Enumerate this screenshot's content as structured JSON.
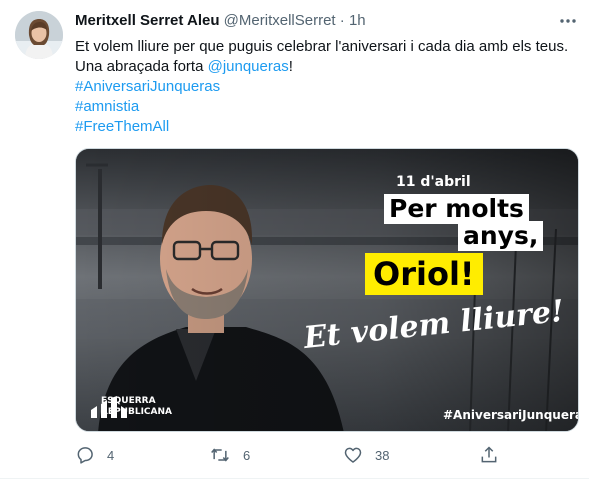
{
  "tweet": {
    "author_name": "Meritxell Serret Aleu",
    "author_handle": "@MeritxellSerret",
    "separator": "·",
    "time": "1h",
    "text_line1": "Et volem lliure per que puguis celebrar l'aniversari i cada dia amb els teus.",
    "text_line2_prefix": "Una abraçada forta ",
    "mention": "@junqueras",
    "text_line2_suffix": "!",
    "hashtags": [
      "#AniversariJunqueras",
      "#amnistia",
      "#FreeThemAll"
    ]
  },
  "image": {
    "date": "11 d'abril",
    "line1": "Per molts",
    "line2": "anys,",
    "line3": "Oriol!",
    "slogan": "Et volem lliure!",
    "logo_line1": "ESQUERRA",
    "logo_line2": "REPUBLICANA",
    "hashtag": "#AniversariJunqueras"
  },
  "actions": {
    "reply_count": "4",
    "retweet_count": "6",
    "like_count": "38"
  },
  "icons": {
    "more": "more-horizontal-icon",
    "reply": "reply-icon",
    "retweet": "retweet-icon",
    "like": "heart-icon",
    "share": "share-icon"
  },
  "colors": {
    "link": "#1d9bf0",
    "secondary_text": "#536471",
    "highlight_yellow": "#ffed00"
  }
}
